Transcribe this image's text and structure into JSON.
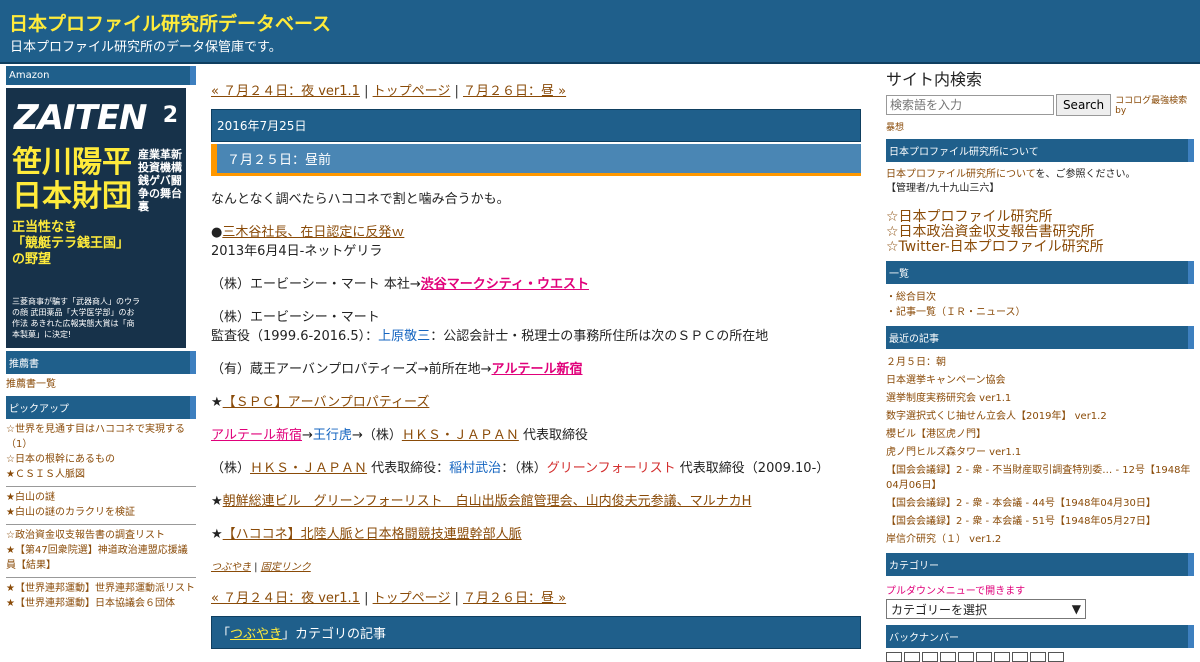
{
  "header": {
    "title": "日本プロファイル研究所データベース",
    "description": "日本プロファイル研究所のデータ保管庫です。"
  },
  "left": {
    "amazon_head": "Amazon",
    "magazine": {
      "logo": "ZAITEN",
      "issue": "2",
      "headline1": "笹川陽平",
      "headline2": "日本財団",
      "sub1": "正当性なき",
      "sub2": "「競艇テラ銭王国」",
      "sub3": "の野望",
      "side": "産業革新投資機構 銭ゲバ闘争の舞台裏",
      "foot": "三菱商事が騙す「武器商人」のウラの顔 武田薬品「大学医学部」のお作法 あきれた広報実態大賞は「商本製菓」に決定!"
    },
    "recommend_head": "推薦書",
    "recommend_link": "推薦書一覧",
    "pickup_head": "ピックアップ",
    "pickup_group1": [
      "☆世界を見通す目はハココネで実現する（1）",
      "☆日本の根幹にあるもの",
      "★ＣＳＩＳ人脈図"
    ],
    "pickup_group2": [
      "★白山の謎",
      "★白山の謎のカラクリを検証"
    ],
    "pickup_group3": [
      "☆政治資金収支報告書の調査リスト",
      "★【第47回衆院選】神道政治連盟応援議員【結果】"
    ],
    "pickup_group4": [
      "★【世界連邦運動】世界連邦運動派リスト",
      "★【世界連邦運動】日本協議会６団体"
    ]
  },
  "main": {
    "nav": {
      "prev": "« ７月２４日：夜 ver1.1",
      "sep1": " | ",
      "top": "トップページ",
      "sep2": " | ",
      "next": "７月２６日：昼 »"
    },
    "date": "2016年7月25日",
    "entry_title": "７月２５日：昼前",
    "intro": "なんとなく調べたらハココネで割と噛み合うかも。",
    "p1_bullet": "●",
    "p1_link": "三木谷社長、在日認定に反発ｗ",
    "p1_line2": "2013年6月4日-ネットゲリラ",
    "p2_text": "（株）エービーシー・マート 本社→",
    "p2_link": "渋谷マークシティ・ウエスト",
    "p3_line1": "（株）エービーシー・マート",
    "p3_a": "監査役（1999.6-2016.5）：",
    "p3_name": "上原敬三",
    "p3_b": "：公認会計士・税理士の事務所住所は次のＳＰＣの所在地",
    "p4_text": "（有）蔵王アーバンプロパティーズ→前所在地→",
    "p4_link": "アルテール新宿",
    "p5_star": "★",
    "p5_link": "【ＳＰＣ】アーバンプロパティーズ",
    "p6_link1": "アルテール新宿",
    "p6_arrow1": "→",
    "p6_name": "王行虎",
    "p6_arrow2": "→（株）",
    "p6_link2": "ＨＫＳ・ＪＡＰＡＮ",
    "p6_tail": " 代表取締役",
    "p7_a": "（株）",
    "p7_link": "ＨＫＳ・ＪＡＰＡＮ",
    "p7_b": " 代表取締役：",
    "p7_name": "稲村武治",
    "p7_c": "：（株）",
    "p7_red": "グリーンフォーリスト",
    "p7_d": " 代表取締役（2009.10-）",
    "p8_star": "★",
    "p8_link": "朝鮮総連ビル　グリーンフォーリスト　白山出版会館管理会、山内俊夫元参議、マルナカH",
    "p9_star": "★",
    "p9_link": "【ハココネ】北陸人脈と日本格闘競技連盟幹部人脈",
    "tag_link": "つぶやき",
    "tag_sep": " | ",
    "perma_link": "固定リンク",
    "cat_prefix": "「",
    "cat_link": "つぶやき",
    "cat_suffix": "」カテゴリの記事"
  },
  "right": {
    "search_title": "サイト内検索",
    "search_placeholder": "検索語を入力",
    "search_button": "Search",
    "search_note": "ココログ最強検索 by",
    "search_note2": "暴想",
    "about_head": "日本プロファイル研究所について",
    "about_link": "日本プロファイル研究所について",
    "about_text": "を、ご参照ください。",
    "about_admin": "【管理者/九十九山三六】",
    "big_links": [
      "☆日本プロファイル研究所",
      "☆日本政治資金収支報告書研究所",
      "☆Twitter-日本プロファイル研究所"
    ],
    "list_head": "一覧",
    "list_items": [
      "・総合目次",
      "・記事一覧（ＩＲ・ニュース）"
    ],
    "recent_head": "最近の記事",
    "recent_items": [
      "２月５日：朝",
      "日本選挙キャンペーン協会",
      "選挙制度実務研究会 ver1.1",
      "数字選択式くじ抽せん立会人【2019年】 ver1.2",
      "櫻ビル【港区虎ノ門】",
      "虎ノ門ヒルズ森タワー ver1.1",
      "【国会会議録】2 - 衆 - 不当財産取引調査特別委… - 12号【1948年04月06日】",
      "【国会会議録】2 - 衆 - 本会議 - 44号【1948年04月30日】",
      "【国会会議録】2 - 衆 - 本会議 - 51号【1948年05月27日】",
      "岸信介研究（１） ver1.2"
    ],
    "category_head": "カテゴリー",
    "category_note": "プルダウンメニューで開きます",
    "category_select": "カテゴリーを選択",
    "backnumber_head": "バックナンバー"
  }
}
